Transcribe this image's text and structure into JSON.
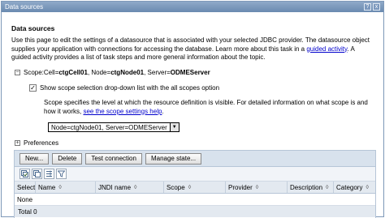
{
  "window": {
    "title": "Data sources",
    "help_label": "?",
    "close_label": "x"
  },
  "page": {
    "heading": "Data sources",
    "description_prefix": "Use this page to edit the settings of a datasource that is associated with your selected JDBC provider. The datasource object supplies your application with connections for accessing the database. Learn more about this task in a ",
    "guided_activity_link": "guided activity",
    "description_suffix": ". A guided activity provides a list of task steps and more general information about the topic."
  },
  "scope": {
    "expander": "−",
    "label": "Scope: ",
    "cell_prefix": "Cell=",
    "cell_value": "ctgCell01",
    "node_prefix": ", Node=",
    "node_value": "ctgNode01",
    "server_prefix": ", Server=",
    "server_value": "ODMEServer",
    "checkbox_label": "Show scope selection drop-down list with the all scopes option",
    "checkbox_checked": true,
    "explain_prefix": "Scope specifies the level at which the resource definition is visible. For detailed information on what scope is and how it works, ",
    "explain_link": "see the scope settings help",
    "explain_suffix": ".",
    "select_value": "Node=ctgNode01, Server=ODMEServer"
  },
  "preferences": {
    "expander": "+",
    "label": "Preferences"
  },
  "toolbar": {
    "new": "New...",
    "delete": "Delete",
    "test": "Test connection",
    "manage": "Manage state..."
  },
  "icon_buttons": [
    "select-all-icon",
    "deselect-all-icon",
    "filter-icon",
    "show-filter-icon"
  ],
  "table": {
    "columns": [
      "Select",
      "Name",
      "JNDI name",
      "Scope",
      "Provider",
      "Description",
      "Category"
    ],
    "sort_glyph": "◊",
    "empty_text": "None",
    "total_text": "Total 0"
  },
  "colors": {
    "titlebar": "#7b98bd",
    "link": "#0000cc",
    "toolbar_bg": "#d8e2ed",
    "header_bg": "#e3e9f0"
  }
}
